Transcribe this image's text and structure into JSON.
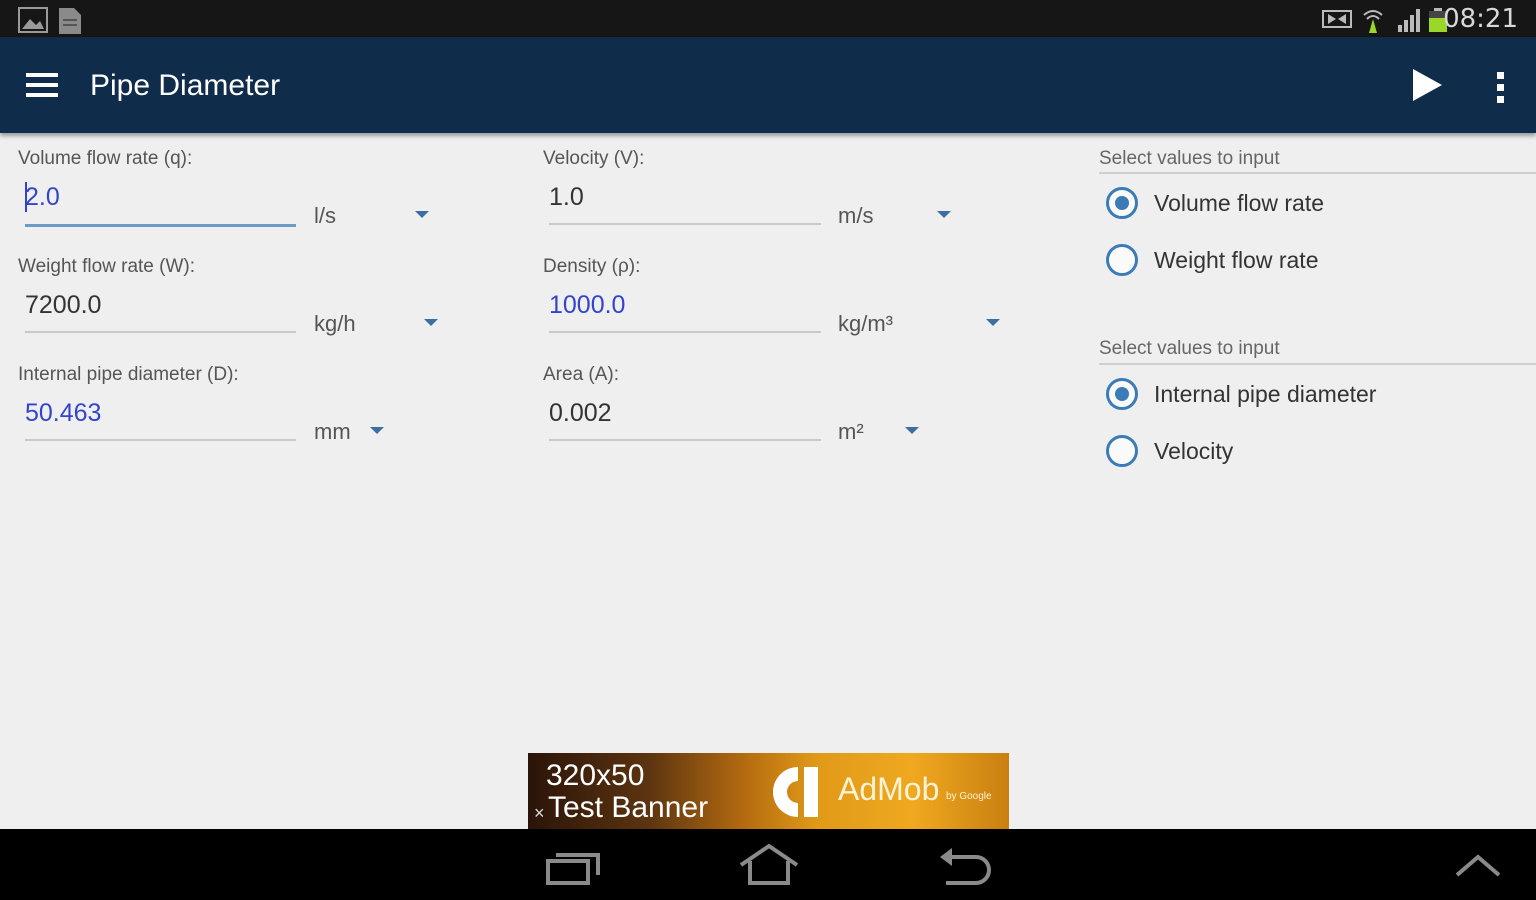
{
  "status_bar": {
    "time": "08:21",
    "left_icons": [
      "gallery-notification-icon",
      "document-notification-icon"
    ],
    "right_icons": [
      "media-notification-icon",
      "wifi-icon",
      "signal-icon",
      "battery-icon"
    ],
    "battery_color": "#9bd62a"
  },
  "action_bar": {
    "title": "Pipe Diameter",
    "background": "#0f2c4a",
    "actions": [
      "menu-icon",
      "run-icon",
      "overflow-icon"
    ]
  },
  "fields": {
    "volume_flow": {
      "label": "Volume flow rate (q):",
      "value": "2.0",
      "unit": "l/s"
    },
    "weight_flow": {
      "label": "Weight flow rate (W):",
      "value": "7200.0",
      "unit": "kg/h"
    },
    "pipe_diameter": {
      "label": "Internal pipe diameter (D):",
      "value": "50.463",
      "unit": "mm"
    },
    "velocity": {
      "label": "Velocity (V):",
      "value": "1.0",
      "unit": "m/s"
    },
    "density": {
      "label": "Density (ρ):",
      "value": "1000.0",
      "unit": "kg/m³"
    },
    "area": {
      "label": "Area (A):",
      "value": "0.002",
      "unit": "m²"
    }
  },
  "radio_groups": [
    {
      "heading": "Select values to input",
      "options": [
        {
          "label": "Volume flow rate",
          "selected": true
        },
        {
          "label": "Weight flow rate",
          "selected": false
        }
      ]
    },
    {
      "heading": "Select values to input",
      "options": [
        {
          "label": "Internal pipe diameter",
          "selected": true
        },
        {
          "label": "Velocity",
          "selected": false
        }
      ]
    }
  ],
  "ad": {
    "line1": "320x50",
    "line2": "Test Banner",
    "close": "×",
    "brand": "AdMob",
    "by": "by Google"
  },
  "nav_bar": {
    "buttons": [
      "recent-apps-icon",
      "home-icon",
      "back-icon",
      "expand-up-icon"
    ]
  },
  "colors": {
    "accent": "#3b7bb6",
    "highlight_text": "#3344cc",
    "background": "#efefef"
  }
}
